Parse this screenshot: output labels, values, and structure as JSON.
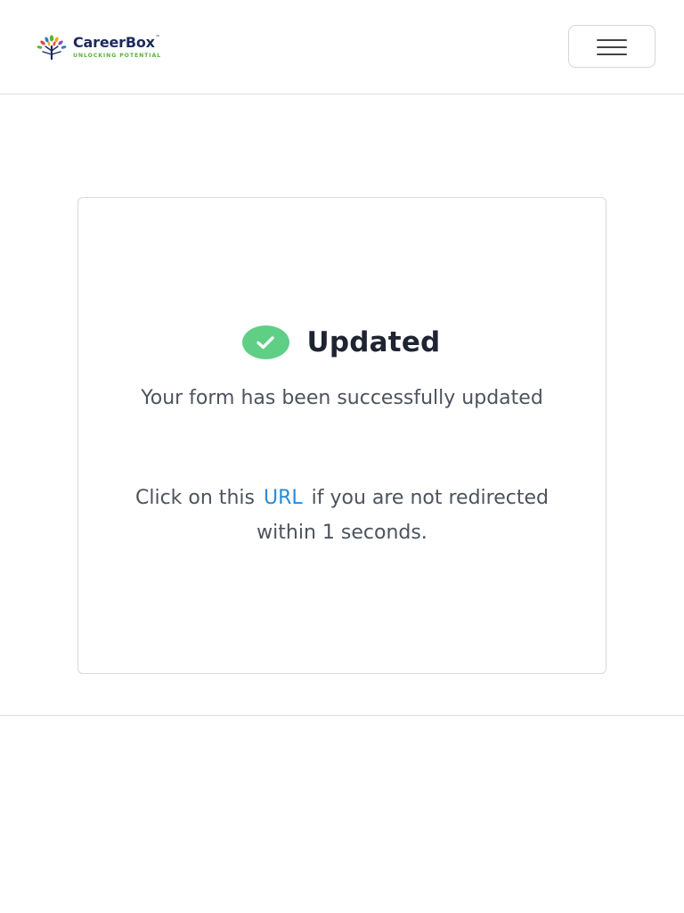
{
  "header": {
    "logo": {
      "name": "CareerBox",
      "trademark": "™",
      "tagline": "UNLOCKING POTENTIAL"
    },
    "menu_button": {
      "icon": "hamburger-menu-icon"
    }
  },
  "card": {
    "status_icon": "check-circle-icon",
    "title": "Updated",
    "message": "Your form has been successfully updated",
    "redirect": {
      "prefix": "Click on this",
      "link_label": "URL",
      "suffix": "if you are not redirected within 1 seconds."
    }
  },
  "colors": {
    "brand_navy": "#1d2a5c",
    "brand_green": "#59b13b",
    "success_green": "#5fcf86",
    "link_blue": "#2d8ad6"
  }
}
